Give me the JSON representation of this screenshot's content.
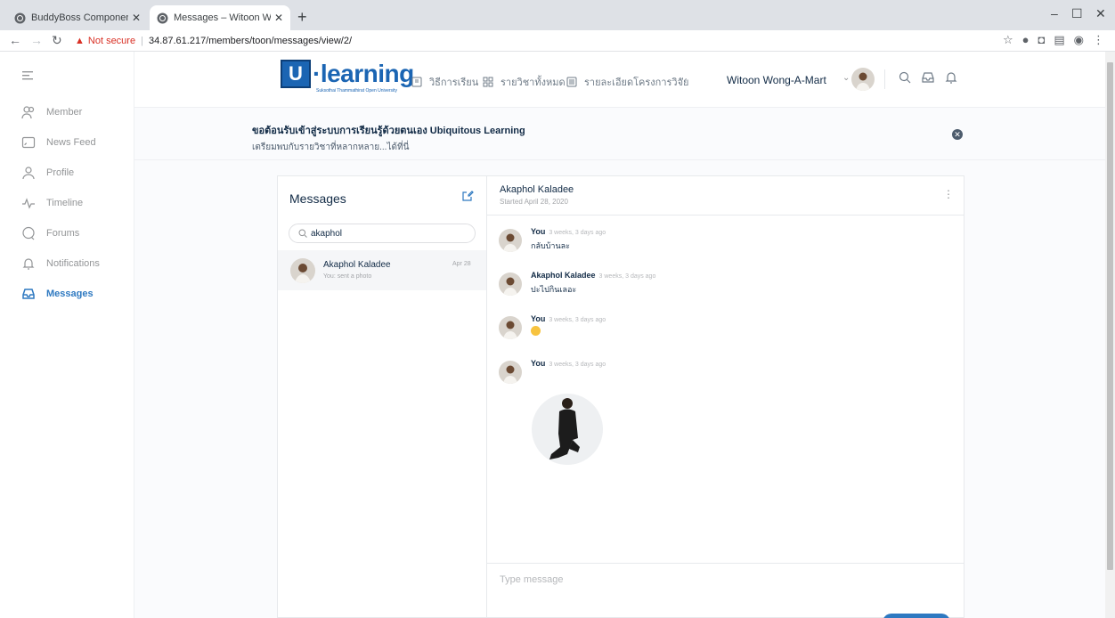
{
  "browser": {
    "tabs": [
      {
        "title": "BuddyBoss Components ‹ U-Lea"
      },
      {
        "title": "Messages – Witoon Wong-A-Ma"
      }
    ],
    "new_tab": "+",
    "address": {
      "warning_label": "Not secure",
      "url": "34.87.61.217/members/toon/messages/view/2/"
    }
  },
  "sidebar": {
    "items": [
      {
        "label": "Member",
        "icon": "member-icon"
      },
      {
        "label": "News Feed",
        "icon": "news-feed-icon"
      },
      {
        "label": "Profile",
        "icon": "profile-icon"
      },
      {
        "label": "Timeline",
        "icon": "timeline-icon"
      },
      {
        "label": "Forums",
        "icon": "forums-icon"
      },
      {
        "label": "Notifications",
        "icon": "bell-icon"
      },
      {
        "label": "Messages",
        "icon": "inbox-icon"
      }
    ],
    "active": "Messages"
  },
  "header": {
    "logo": {
      "box": "U",
      "text": "·learning",
      "sub": "Suksothai Thammathirat Open University"
    },
    "menu": [
      {
        "label": "วิธีการเรียน",
        "icon": "book-icon"
      },
      {
        "label": "รายวิชาทั้งหมด",
        "icon": "grid-icon"
      },
      {
        "label": "รายละเอียดโครงการวิจัย",
        "icon": "list-icon"
      }
    ],
    "more": "···",
    "user_name": "Witoon Wong-A-Mart"
  },
  "notice": {
    "title": "ขอต้อนรับเข้าสู่ระบบการเรียนรู้ด้วยตนเอง Ubiquitous Learning",
    "subtitle": "เตรียมพบกับรายวิชาที่หลากหลาย...ได้ที่นี่"
  },
  "messages": {
    "title": "Messages",
    "search_value": "akaphol",
    "threads": [
      {
        "name": "Akaphol Kaladee",
        "preview": "You: sent a photo",
        "date": "Apr 28"
      }
    ],
    "conversation": {
      "name": "Akaphol Kaladee",
      "started": "Started April 28, 2020",
      "items": [
        {
          "author": "You",
          "time": "3 weeks, 3 days ago",
          "text": "กลับบ้านละ"
        },
        {
          "author": "Akaphol Kaladee",
          "time": "3 weeks, 3 days ago",
          "text": "ปะไปกินเลอะ"
        },
        {
          "author": "You",
          "time": "3 weeks, 3 days ago",
          "text": ""
        },
        {
          "author": "You",
          "time": "3 weeks, 3 days ago",
          "text": ""
        }
      ]
    },
    "compose_placeholder": "Type message"
  },
  "colors": {
    "accent": "#2e79c1",
    "brand": "#1b65b3",
    "text": "#122b46",
    "muted": "#939597"
  }
}
